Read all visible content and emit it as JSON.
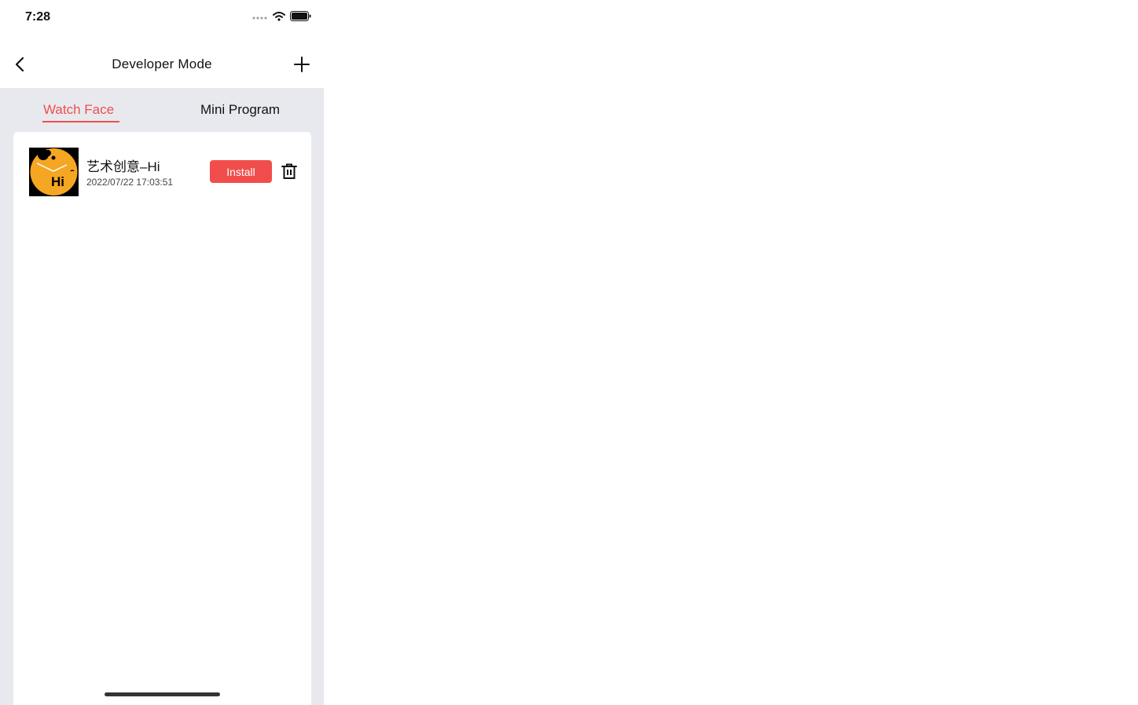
{
  "status_bar": {
    "time": "7:28",
    "icons": [
      "signal-icon",
      "wifi-icon",
      "battery-icon"
    ]
  },
  "nav": {
    "title": "Developer Mode",
    "back_icon": "chevron-left-icon",
    "add_icon": "plus-icon"
  },
  "tabs": [
    {
      "label": "Watch Face",
      "active": true
    },
    {
      "label": "Mini Program",
      "active": false
    }
  ],
  "items": [
    {
      "title": "艺术创意–Hi",
      "date": "2022/07/22 17:03:51",
      "install_label": "Install",
      "thumb_text": "Hi",
      "delete_icon": "trash-icon"
    }
  ],
  "colors": {
    "accent": "#f24d4d",
    "background": "#e8e9ee",
    "card": "#ffffff",
    "thumb_orange": "#f5a623"
  }
}
